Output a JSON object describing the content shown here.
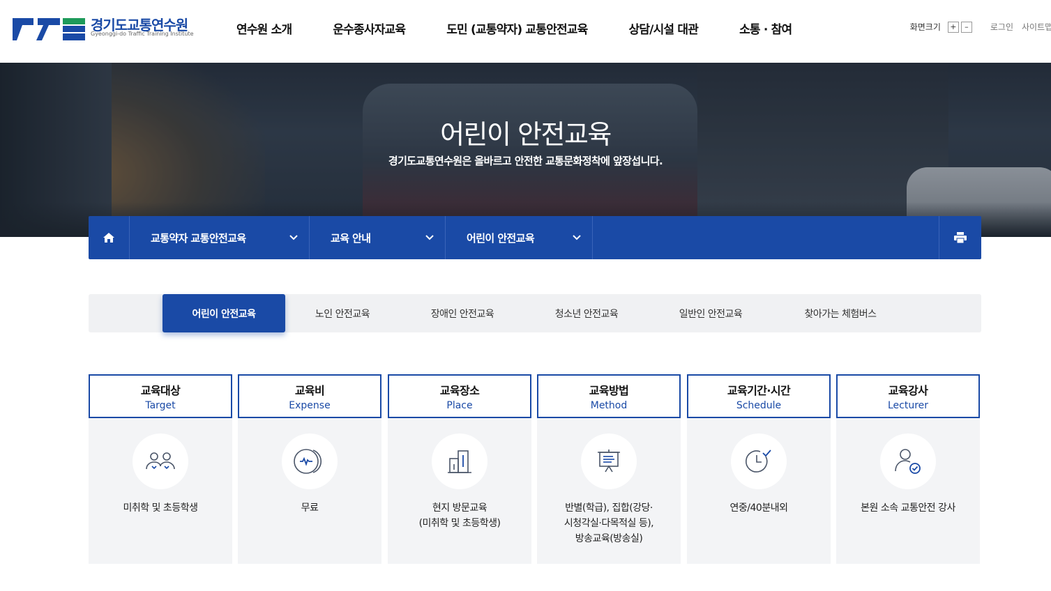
{
  "header": {
    "logo_title": "경기도교통연수원",
    "logo_sub": "Gyeonggi-do Traffic Training Institute",
    "nav": [
      "연수원 소개",
      "운수종사자교육",
      "도민 (교통약자) 교통안전교육",
      "상담/시설 대관",
      "소통 · 참여"
    ],
    "font_size_label": "화면크기",
    "font_plus": "+",
    "font_minus": "–",
    "login": "로그인",
    "sitemap": "사이트맵"
  },
  "hero": {
    "title": "어린이 안전교육",
    "subtitle": "경기도교통연수원은 올바르고 안전한 교통문화정착에 앞장섭니다."
  },
  "location": {
    "home_icon": "home-icon",
    "items": [
      "교통약자 교통안전교육",
      "교육 안내",
      "어린이 안전교육"
    ],
    "print_icon": "print-icon"
  },
  "tabs": {
    "items": [
      "어린이 안전교육",
      "노인 안전교육",
      "장애인 안전교육",
      "청소년 안전교육",
      "일반인 안전교육",
      "찾아가는 체험버스"
    ],
    "active": "어린이 안전교육"
  },
  "cards": [
    {
      "title": "교육대상",
      "en": "Target",
      "icon": "people-icon",
      "desc": "미취학 및 초등학생"
    },
    {
      "title": "교육비",
      "en": "Expense",
      "icon": "coin-icon",
      "desc": "무료"
    },
    {
      "title": "교육장소",
      "en": "Place",
      "icon": "building-icon",
      "desc": "현지 방문교육\n(미취학 및 초등학생)"
    },
    {
      "title": "교육방법",
      "en": "Method",
      "icon": "presentation-icon",
      "desc": "반별(학급), 집합(강당·\n시청각실·다목적실 등),\n방송교육(방송실)"
    },
    {
      "title": "교육기간·시간",
      "en": "Schedule",
      "icon": "clock-icon",
      "desc": "연중/40분내외"
    },
    {
      "title": "교육강사",
      "en": "Lecturer",
      "icon": "lecturer-icon",
      "desc": "본원 소속 교통안전 강사"
    }
  ],
  "colors": {
    "primary": "#1a4aa6",
    "logo_green": "#1e9a5a",
    "card_bg": "#f3f4f6",
    "tab_bg": "#f0f1f3"
  }
}
